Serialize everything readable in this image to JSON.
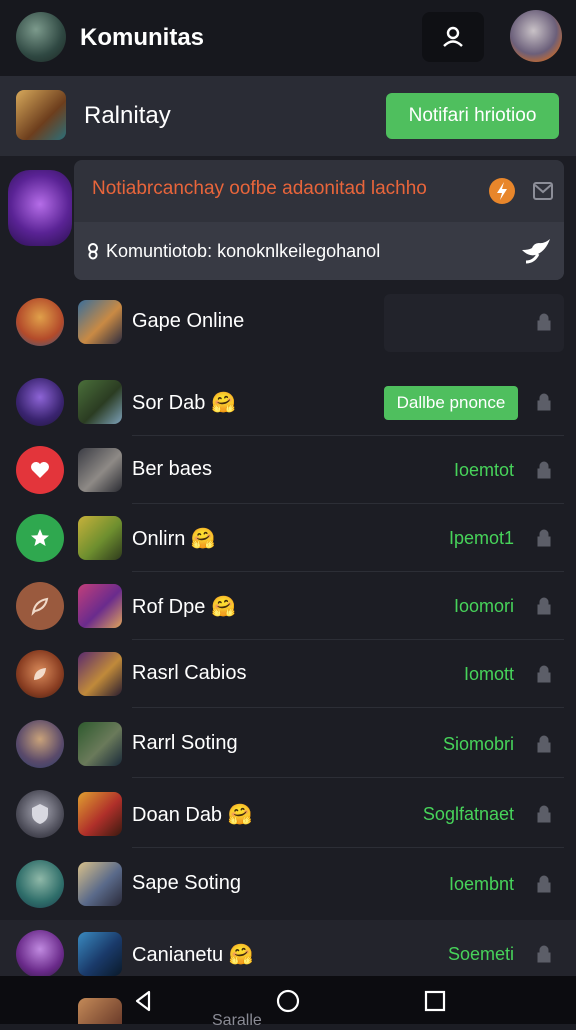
{
  "top": {
    "title": "Komunitas"
  },
  "header": {
    "title": "Ralnitay",
    "notify_label": "Notifari hriotioo"
  },
  "notification": {
    "line1": "Notiabrcanchay oofbe adaonitad lachho",
    "line2": "Komuntiotob: konoknlkeilegohanol"
  },
  "rows": [
    {
      "name": "Gape Online",
      "status": ""
    },
    {
      "name": "Sor Dab",
      "emoji": "🤗",
      "button": "Dallbe pnonce"
    },
    {
      "name": "Ber baes",
      "status": "Ioemtot"
    },
    {
      "name": "Onlirn",
      "emoji": "🤗",
      "status": "Ipemot1"
    },
    {
      "name": "Rof Dpe",
      "emoji": "🤗",
      "status": "Ioomori"
    },
    {
      "name": "Rasrl Cabios",
      "status": "Iomott"
    },
    {
      "name": "Rarrl Soting",
      "status": "Siomobri"
    },
    {
      "name": "Doan Dab",
      "emoji": "🤗",
      "status": "Soglfatnaet"
    },
    {
      "name": "Sape Soting",
      "status": "Ioembnt"
    },
    {
      "name": "Canianetu",
      "emoji": "🤗",
      "status": "Soemeti"
    }
  ],
  "bottom": {
    "peek_label": "Saralle"
  },
  "colors": {
    "accent_green": "#4fbf5e",
    "status_green": "#47d35a",
    "alert_orange": "#e8653b"
  }
}
